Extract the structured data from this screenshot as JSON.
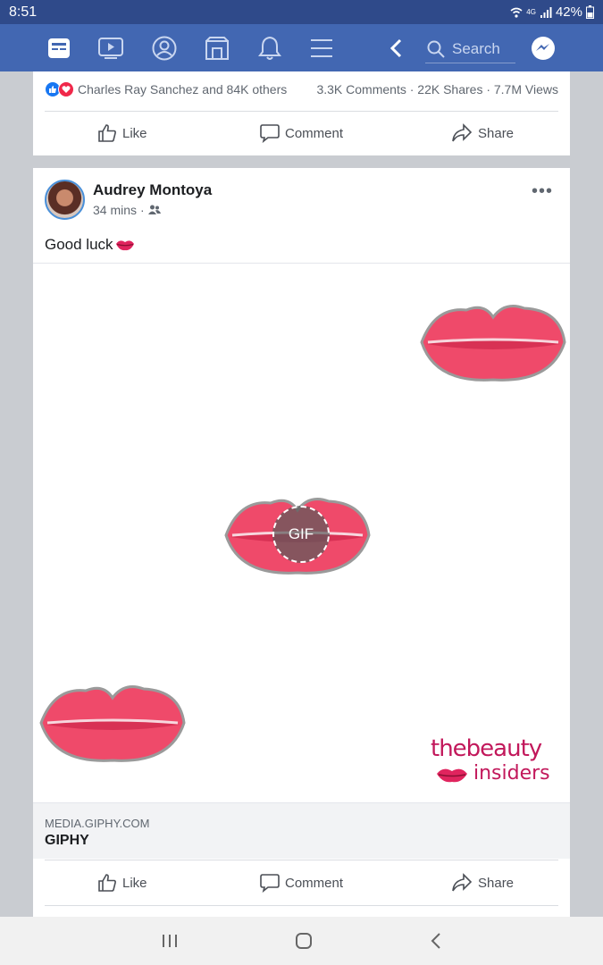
{
  "status_bar": {
    "time": "8:51",
    "network": "4G",
    "battery": "42%"
  },
  "top_nav": {
    "icons": [
      "news-feed-icon",
      "watch-icon",
      "profile-icon",
      "marketplace-icon",
      "notifications-icon",
      "menu-icon",
      "back-icon",
      "search-icon",
      "messenger-icon"
    ],
    "search_placeholder": "Search",
    "bar_color": "#4267b2"
  },
  "previous_post": {
    "reactions_text": "Charles Ray Sanchez and 84K others",
    "stats": "3.3K Comments · 22K Shares · 7.7M Views",
    "actions": {
      "like": "Like",
      "comment": "Comment",
      "share": "Share"
    }
  },
  "post": {
    "author": "Audrey Montoya",
    "time": "34 mins",
    "privacy_icon": "friends-icon",
    "text": "Good luck",
    "text_emoji": "lips-emoji",
    "gif_badge": "GIF",
    "watermark_line1": "thebeauty",
    "watermark_line2": "insiders",
    "link_domain": "MEDIA.GIPHY.COM",
    "link_title": "GIPHY",
    "actions": {
      "like": "Like",
      "comment": "Comment",
      "share": "Share"
    }
  },
  "system_nav": {
    "icons": [
      "recent-apps-icon",
      "home-icon",
      "back-icon"
    ]
  }
}
